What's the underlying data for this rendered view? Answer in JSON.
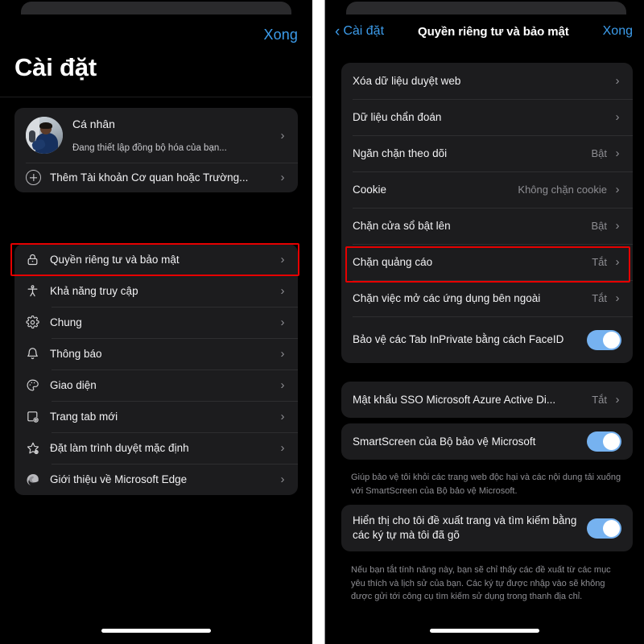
{
  "left_panel": {
    "done_label": "Xong",
    "title": "Cài đặt",
    "account": {
      "name": "Cá nhân",
      "subtitle": "Đang thiết lập đồng bộ hóa của bạn...",
      "chevron": "›",
      "avatar_icon": "user-photo-avatar"
    },
    "add_account": {
      "label": "Thêm Tài khoản Cơ quan hoặc Trường...",
      "chevron": "›",
      "icon": "plus-circle-icon"
    },
    "menu": [
      {
        "label": "Quyền riêng tư và bảo mật",
        "icon": "lock-icon",
        "chevron": "›",
        "highlighted": true
      },
      {
        "label": "Khả năng truy cập",
        "icon": "accessibility-icon",
        "chevron": "›",
        "highlighted": false
      },
      {
        "label": "Chung",
        "icon": "gear-icon",
        "chevron": "›",
        "highlighted": false
      },
      {
        "label": "Thông báo",
        "icon": "bell-icon",
        "chevron": "›",
        "highlighted": false
      },
      {
        "label": "Giao diện",
        "icon": "palette-icon",
        "chevron": "›",
        "highlighted": false
      },
      {
        "label": "Trang tab mới",
        "icon": "new-tab-icon",
        "chevron": "›",
        "highlighted": false
      },
      {
        "label": "Đặt làm trình duyệt mặc định",
        "icon": "star-gear-icon",
        "chevron": "›",
        "highlighted": false
      },
      {
        "label": "Giới thiệu về Microsoft Edge",
        "icon": "edge-logo-icon",
        "chevron": "›",
        "highlighted": false
      }
    ]
  },
  "right_panel": {
    "back_label": "Cài đặt",
    "back_icon": "chevron-left-icon",
    "title": "Quyền riêng tư và bảo mật",
    "done_label": "Xong",
    "group1": [
      {
        "label": "Xóa dữ liệu duyệt web",
        "value": "",
        "type": "chevron",
        "chevron": "›"
      },
      {
        "label": "Dữ liệu chẩn đoán",
        "value": "",
        "type": "chevron",
        "chevron": "›"
      },
      {
        "label": "Ngăn chặn theo dõi",
        "value": "Bật",
        "type": "chevron",
        "chevron": "›"
      },
      {
        "label": "Cookie",
        "value": "Không chặn cookie",
        "type": "chevron",
        "chevron": "›"
      },
      {
        "label": "Chặn cửa sổ bật lên",
        "value": "Bật",
        "type": "chevron",
        "chevron": "›"
      },
      {
        "label": "Chặn quảng cáo",
        "value": "Tắt",
        "type": "chevron",
        "chevron": "›",
        "highlighted": true
      },
      {
        "label": "Chặn việc mở các ứng dụng bên ngoài",
        "value": "Tắt",
        "type": "chevron",
        "chevron": "›"
      },
      {
        "label": "Bảo vệ các Tab InPrivate bằng cách FaceID",
        "value": "",
        "type": "toggle",
        "toggle_on": true
      }
    ],
    "group2": [
      {
        "label": "Mật khẩu SSO Microsoft Azure Active Di...",
        "value": "Tắt",
        "type": "chevron",
        "chevron": "›"
      }
    ],
    "group3": [
      {
        "label": "SmartScreen của Bộ bảo vệ Microsoft",
        "value": "",
        "type": "toggle",
        "toggle_on": true
      }
    ],
    "footnote1": "Giúp bảo vệ tôi khỏi các trang web độc hại và các nội dung tải xuống với SmartScreen của Bộ bảo vệ Microsoft.",
    "group4": [
      {
        "label": "Hiển thị cho tôi đề xuất trang và tìm kiếm bằng các ký tự mà tôi đã gõ",
        "value": "",
        "type": "toggle",
        "toggle_on": true
      }
    ],
    "footnote2": "Nếu bạn tắt tính năng này, bạn sẽ chỉ thấy các đề xuất từ các mục yêu thích và lịch sử của bạn. Các ký tự được nhập vào sẽ không được gửi tới công cụ tìm kiếm sử dụng trong thanh địa chỉ."
  },
  "colors": {
    "accent_blue": "#3c9ceb",
    "toggle_on": "#76b2f0",
    "highlight_red": "#e60000",
    "card_bg": "#1c1c1e",
    "page_bg": "#000000"
  }
}
